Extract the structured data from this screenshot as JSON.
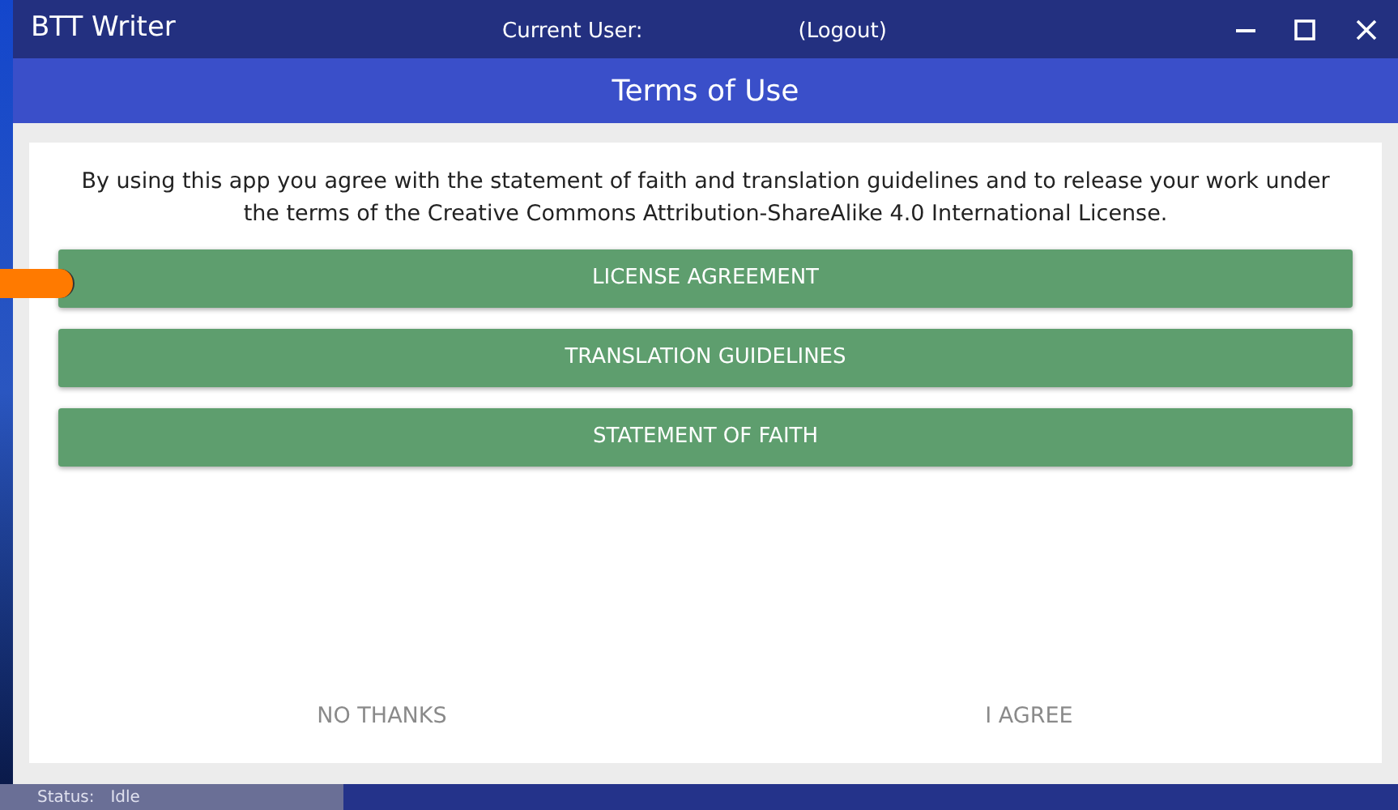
{
  "window": {
    "title": "BTT Writer",
    "user_label": "Current User:",
    "logout": "(Logout)"
  },
  "header": {
    "title": "Terms of Use"
  },
  "intro": "By using this app you agree with the statement of faith and translation guidelines and to release your work under the terms of the Creative Commons Attribution-ShareAlike 4.0 International License.",
  "buttons": [
    {
      "label": "LICENSE AGREEMENT"
    },
    {
      "label": "TRANSLATION GUIDELINES"
    },
    {
      "label": "STATEMENT OF FAITH"
    }
  ],
  "actions": [
    {
      "label": "NO THANKS"
    },
    {
      "label": "I AGREE"
    }
  ],
  "status_bar": {
    "label": "Status:",
    "value": "Idle"
  }
}
